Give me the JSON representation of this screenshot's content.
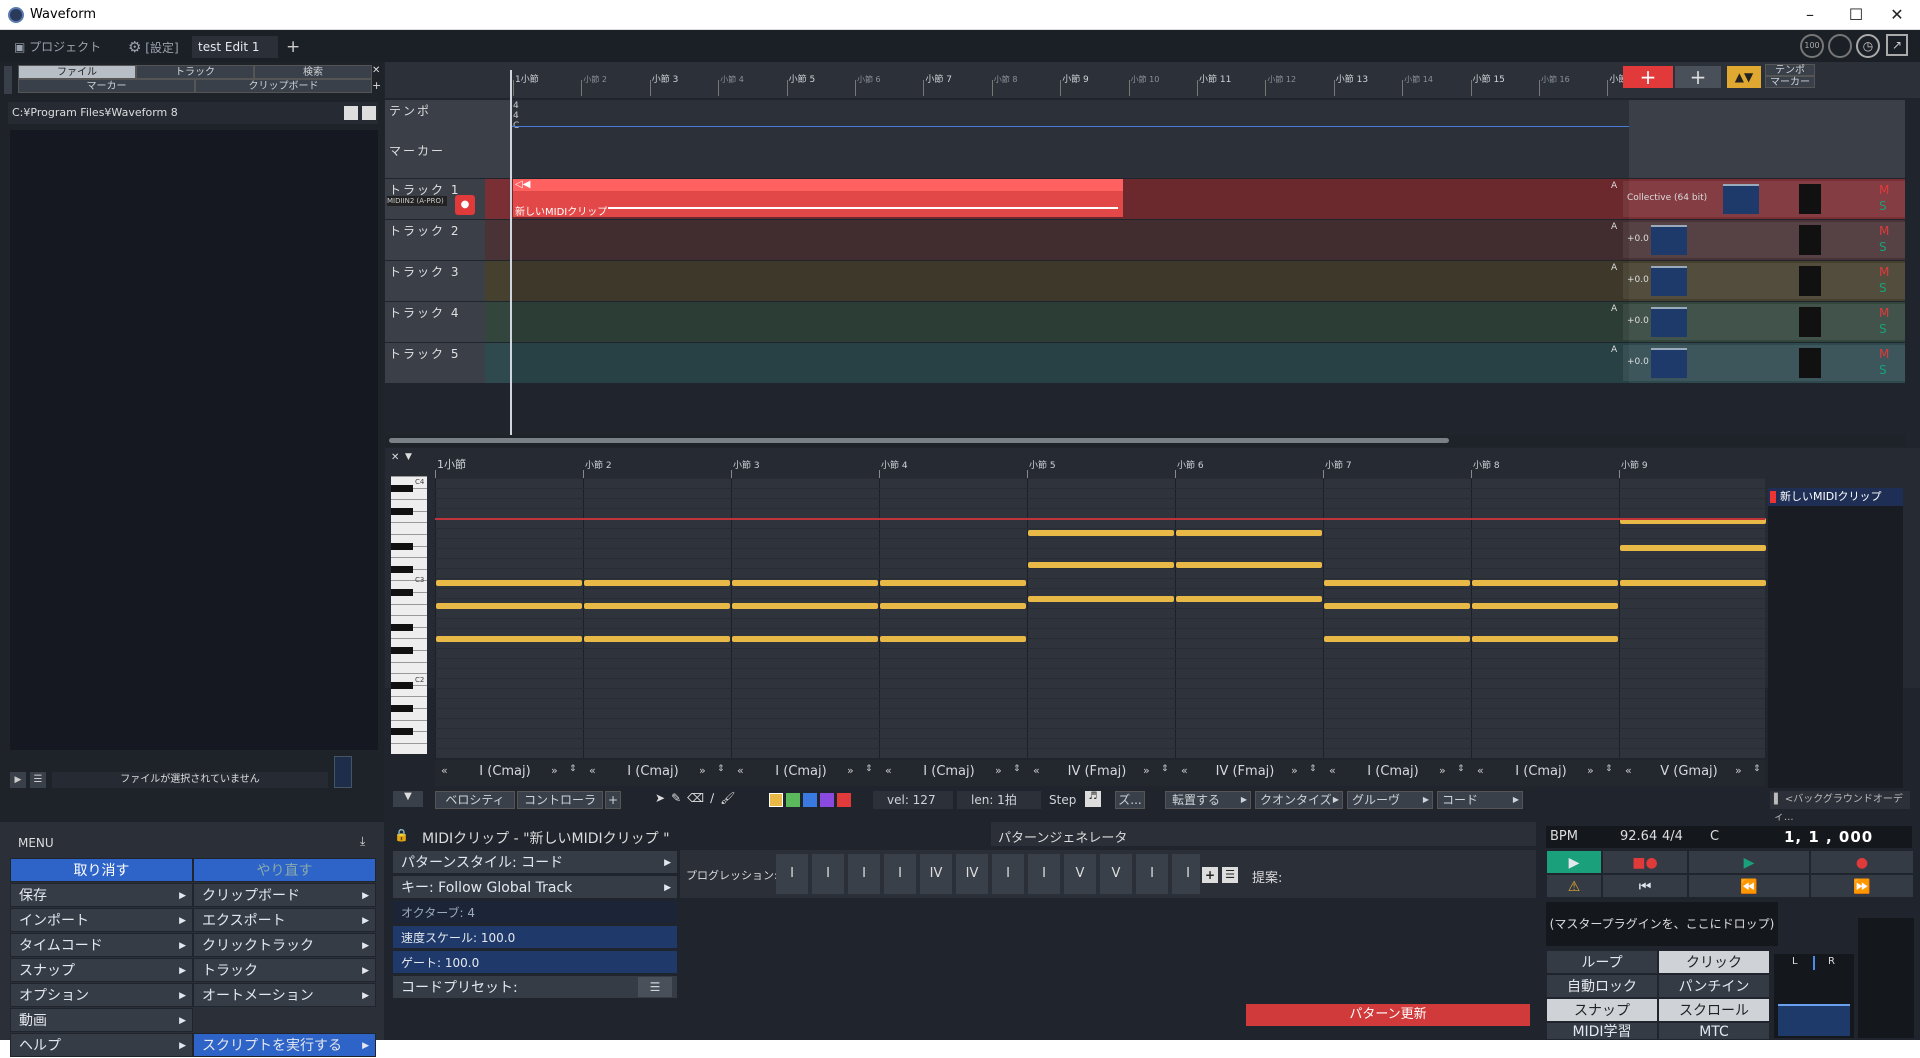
{
  "window": {
    "title": "Waveform"
  },
  "tabs": {
    "project": "プロジェクト",
    "settings": "[設定]",
    "edit": "test Edit 1"
  },
  "browser": {
    "tab_file": "ファイル",
    "tab_track": "トラック",
    "tab_search": "検索",
    "tab_marker": "マーカー",
    "tab_clipboard": "クリップボード",
    "path": "C:¥Program Files¥Waveform 8",
    "status": "ファイルが選択されていません"
  },
  "ruler": {
    "bars": [
      "1小節",
      "小節 2",
      "小節 3",
      "小節 4",
      "小節 5",
      "小節 6",
      "小節 7",
      "小節 8",
      "小節 9",
      "小節 10",
      "小節 11",
      "小節 12",
      "小節 13",
      "小節 14",
      "小節 15",
      "小節 16",
      "小節"
    ]
  },
  "right_top": {
    "tempo": "テンポ",
    "marker": "マーカー"
  },
  "rows": {
    "tempo": "テンポ",
    "marker": "マーカー",
    "sig_a": "4",
    "sig_b": "4",
    "key": "C"
  },
  "tracks": [
    {
      "name": "トラック 1",
      "input": "MIDIIN2 (A-PRO)",
      "plugin": "Collective (64 bit)",
      "color": "#7a2f35",
      "m": "M",
      "s": "S"
    },
    {
      "name": "トラック 2",
      "plugin": "+0.0 dB",
      "color": "#4a3336",
      "m": "M",
      "s": "S"
    },
    {
      "name": "トラック 3",
      "plugin": "+0.0 dB",
      "color": "#46402f",
      "m": "M",
      "s": "S"
    },
    {
      "name": "トラック 4",
      "plugin": "+0.0 dB",
      "color": "#33463d",
      "m": "M",
      "s": "S"
    },
    {
      "name": "トラック 5",
      "plugin": "+0.0 dB",
      "color": "#2e4a4f",
      "m": "M",
      "s": "S"
    }
  ],
  "clip": {
    "name": "新しいMIDIクリップ"
  },
  "editor": {
    "bars": [
      "1小節",
      "小節 2",
      "小節 3",
      "小節 4",
      "小節 5",
      "小節 6",
      "小節 7",
      "小節 8",
      "小節 9"
    ],
    "oct_c4": "C4",
    "oct_c3": "C3",
    "oct_c2": "C2",
    "chords": [
      "I (Cmaj)",
      "I (Cmaj)",
      "I (Cmaj)",
      "I (Cmaj)",
      "IV (Fmaj)",
      "IV (Fmaj)",
      "I (Cmaj)",
      "I (Cmaj)",
      "V (Gmaj)"
    ],
    "clip_label": "新しいMIDIクリップ",
    "velocity": "ベロシティ",
    "controller": "コントローラ",
    "vel": "vel: 127",
    "len": "len: 1拍",
    "step": "Step",
    "zoom": "ズ...",
    "transpose": "転置する",
    "quantize": "クオンタイズ",
    "groove": "グルーヴ",
    "chord": "コード",
    "background": "<バックグラウンドオーディ..."
  },
  "menu": {
    "title": "MENU",
    "undo": "取り消す",
    "redo": "やり直す",
    "left": [
      "保存",
      "インポート",
      "タイムコード",
      "スナップ",
      "オプション",
      "動画",
      "ヘルプ"
    ],
    "right": [
      "クリップボード",
      "エクスポート",
      "クリックトラック",
      "トラック",
      "オートメーション",
      "スクリプトを実行する"
    ]
  },
  "pattern": {
    "clip_title": "MIDIクリップ - \"新しいMIDIクリップ \"",
    "gen_title": "パターンジェネレータ",
    "style": "パターンスタイル: コード",
    "key": "キー: Follow Global Track",
    "octave": "オクターブ: 4",
    "velscale": "速度スケール: 100.0",
    "gate": "ゲート: 100.0",
    "preset": "コードプリセット:",
    "progression_label": "プログレッション:",
    "progression": [
      "I",
      "I",
      "I",
      "I",
      "IV",
      "IV",
      "I",
      "I",
      "V",
      "V",
      "I",
      "I"
    ],
    "suggest": "提案:",
    "update": "パターン更新"
  },
  "transport": {
    "bpm_label": "BPM",
    "bpm": "92.64",
    "sig": "4/4",
    "key": "C",
    "position": "1, 1 , 000",
    "plugin_drop": "(マスタープラグインを、ここにドロップ)",
    "loop": "ループ",
    "click": "クリック",
    "autolock": "自動ロック",
    "punch": "パンチイン",
    "snap": "スナップ",
    "scroll": "スクロール",
    "midilearn": "MIDI学習",
    "mtc": "MTC",
    "l": "L",
    "r": "R"
  },
  "top_right": {
    "cpu": "100"
  }
}
